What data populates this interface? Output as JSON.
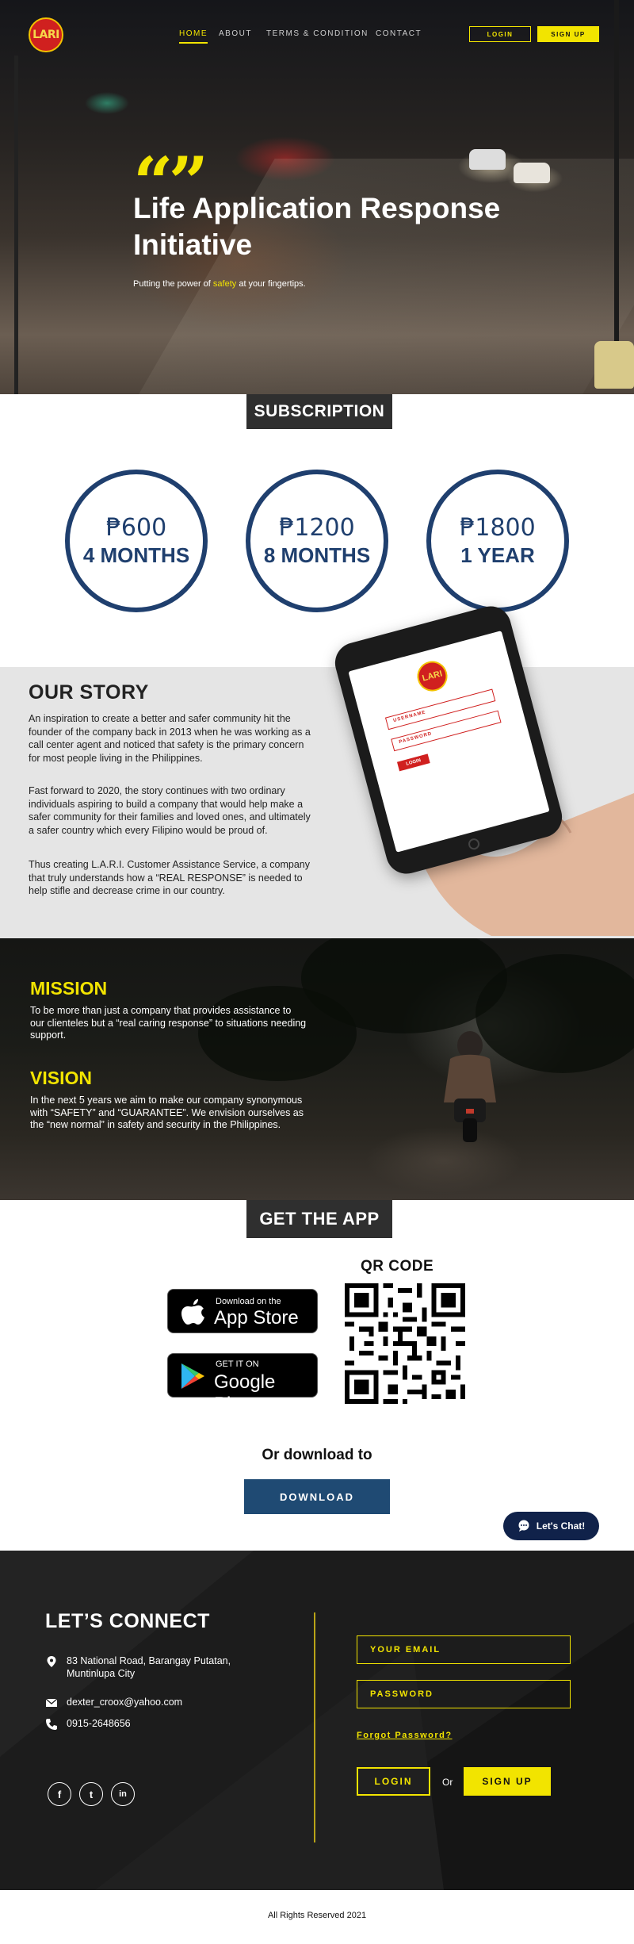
{
  "nav": {
    "logo_text": "LARI",
    "links": [
      "HOME",
      "ABOUT",
      "TERMS & CONDITION",
      "CONTACT"
    ],
    "login_label": "LOGIN",
    "signup_label": "SIGN UP"
  },
  "hero": {
    "title": "Life Application Response Initiative",
    "sub_before": "Putting the power of ",
    "sub_highlight": "safety",
    "sub_after": " at your fingertips."
  },
  "subscription": {
    "heading": "SUBSCRIPTION",
    "plans": [
      {
        "price": "₱600",
        "duration": "4 MONTHS"
      },
      {
        "price": "₱1200",
        "duration": "8 MONTHS"
      },
      {
        "price": "₱1800",
        "duration": "1 YEAR"
      }
    ]
  },
  "story": {
    "heading": "OUR STORY",
    "paragraphs": [
      "An inspiration to create a better and safer community hit the founder of the company back in 2013 when he was working as a call center agent and noticed that safety is the primary concern for most people living in the Philippines.",
      "Fast forward to 2020, the story continues with two ordinary individuals aspiring to build a company that would help make a safer community for their families and loved ones, and ultimately a safer country which every Filipino would be proud of.",
      "Thus creating L.A.R.I. Customer Assistance Service, a company that truly understands how a “REAL RESPONSE” is needed to help stifle and decrease crime in our country."
    ],
    "phone": {
      "logo_text": "LARI",
      "username_label": "USERNAME",
      "password_label": "PASSWORD",
      "login_label": "LOGIN"
    }
  },
  "mission": {
    "mission_heading": "MISSION",
    "mission_text": "To be more than just a company that provides assistance to our clienteles but a “real caring response” to situations needing support.",
    "vision_heading": "VISION",
    "vision_text": "In the next 5 years we aim to make our company synonymous with “SAFETY” and “GUARANTEE”. We envision ourselves as the “new normal” in safety and security in the Philippines."
  },
  "get_app": {
    "heading": "GET THE APP",
    "appstore_small": "Download on the",
    "appstore_big": "App Store",
    "googleplay_small": "GET IT ON",
    "googleplay_big": "Google Play",
    "qr_label": "QR CODE",
    "or_download": "Or download to",
    "download_label": "DOWNLOAD",
    "chat_label": "Let's Chat!"
  },
  "connect": {
    "heading": "LET’S CONNECT",
    "address": "83 National Road, Barangay Putatan, Muntinlupa City",
    "email": "dexter_croox@yahoo.com",
    "phone": "0915-2648656",
    "email_placeholder": "YOUR EMAIL",
    "password_placeholder": "PASSWORD",
    "forgot_label": "Forgot Password?",
    "login_label": "LOGIN",
    "or_label": "Or",
    "signup_label": "SIGN UP",
    "social": [
      "f",
      "t",
      "in"
    ]
  },
  "footer": {
    "copyright": "All Rights Reserved 2021"
  },
  "colors": {
    "accent_yellow": "#f2e400",
    "navy": "#1f3f6e",
    "lari_red": "#d0201f"
  },
  "icons": [
    "quote-icon",
    "apple-icon",
    "google-play-icon",
    "chat-bubble-icon",
    "location-pin-icon",
    "envelope-icon",
    "phone-icon",
    "facebook-icon",
    "twitter-icon",
    "linkedin-icon"
  ]
}
